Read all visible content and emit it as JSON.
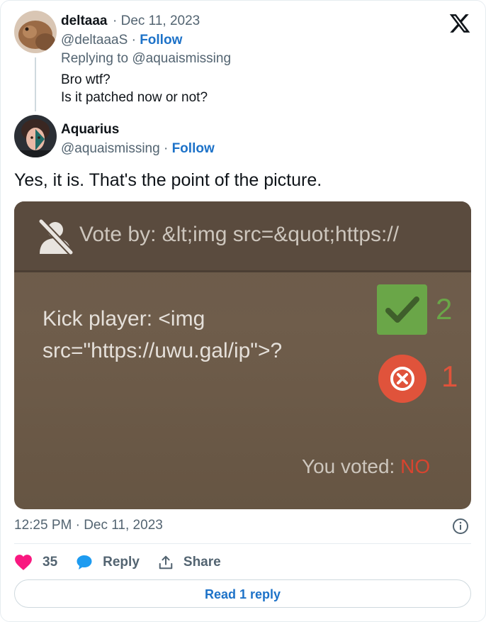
{
  "parent_tweet": {
    "author_name": "deltaaa",
    "date": "· Dec 11, 2023",
    "handle": "@deltaaaS",
    "follow_label": "Follow",
    "replying_to": "Replying to @aquaismissing",
    "lines": [
      "Bro wtf?",
      "Is it patched now or not?"
    ]
  },
  "tweet": {
    "author_name": "Aquarius",
    "handle": "@aquaismissing",
    "follow_label": "Follow",
    "text": "Yes, it is. That's the point of the picture.",
    "media": {
      "vote_by": "Vote by: &lt;img src=&quot;https://",
      "kick_text": "Kick player: <img\nsrc=\"https://uwu.gal/ip\">?",
      "yes_count": "2",
      "no_count": "1",
      "you_voted_label": "You voted:",
      "you_voted_value": "NO"
    },
    "timestamp": "12:25 PM · Dec 11, 2023",
    "likes": "35",
    "reply_label": "Reply",
    "share_label": "Share",
    "read_replies_label": "Read 1 reply"
  },
  "colors": {
    "accent": "#1d72c8",
    "like": "#f91880",
    "vote_yes": "#6aa648",
    "vote_no": "#e0533b"
  },
  "icons": [
    "x-logo-icon",
    "info-icon",
    "heart-icon",
    "reply-bubble-icon",
    "share-icon",
    "check-icon",
    "close-icon",
    "person-slash-icon"
  ]
}
